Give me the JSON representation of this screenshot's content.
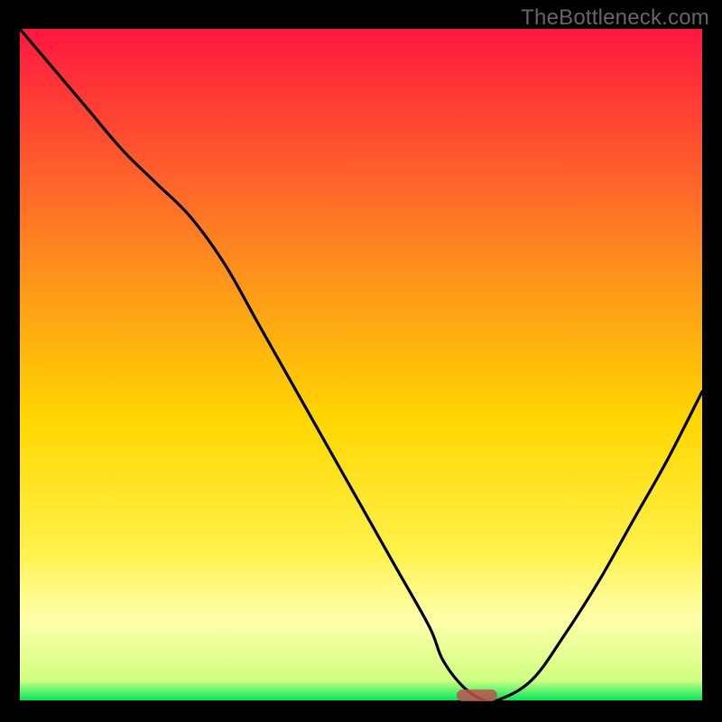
{
  "watermark": "TheBottleneck.com",
  "colors": {
    "top": "#ff173f",
    "mid_upper": "#ff7a1f",
    "mid": "#ffd400",
    "mid_lower": "#fff24a",
    "pale": "#ffffa8",
    "green": "#00ea5a",
    "line": "#000000",
    "marker": "#c05050"
  },
  "chart_data": {
    "type": "line",
    "title": "",
    "xlabel": "",
    "ylabel": "",
    "xlim": [
      0,
      100
    ],
    "ylim": [
      0,
      100
    ],
    "series": [
      {
        "name": "bottleneck-curve",
        "x": [
          0,
          5,
          10,
          15,
          20,
          25,
          30,
          35,
          40,
          45,
          50,
          55,
          60,
          62,
          65,
          68,
          70,
          75,
          80,
          85,
          90,
          95,
          100
        ],
        "y": [
          100,
          94,
          88,
          82,
          77,
          72,
          65,
          56,
          47,
          38,
          29,
          20,
          11,
          6,
          2,
          0,
          0,
          3,
          10,
          18,
          27,
          36,
          46
        ]
      }
    ],
    "annotations": [
      {
        "name": "optimal-marker",
        "x_start": 64,
        "x_end": 70,
        "y": 0
      }
    ],
    "background_gradient": [
      {
        "stop": 0.0,
        "color": "#ff173f"
      },
      {
        "stop": 0.34,
        "color": "#ff8a1f"
      },
      {
        "stop": 0.58,
        "color": "#ffd600"
      },
      {
        "stop": 0.78,
        "color": "#fff24a"
      },
      {
        "stop": 0.88,
        "color": "#ffffa8"
      },
      {
        "stop": 0.97,
        "color": "#d0ff80"
      },
      {
        "stop": 1.0,
        "color": "#00ea5a"
      }
    ]
  }
}
